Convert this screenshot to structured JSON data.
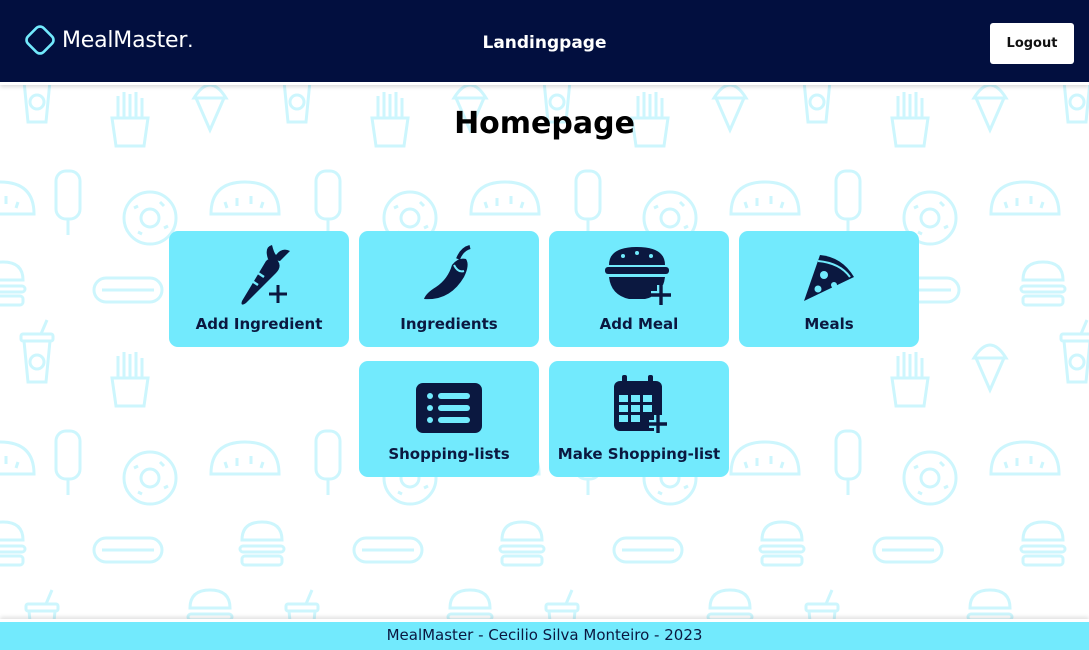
{
  "header": {
    "app_name": "MealMaster",
    "app_name_suffix": ".",
    "page_label": "Landingpage",
    "logout_label": "Logout"
  },
  "main": {
    "title": "Homepage",
    "tiles": [
      {
        "label": "Add Ingredient",
        "icon": "carrot-plus-icon"
      },
      {
        "label": "Ingredients",
        "icon": "pepper-icon"
      },
      {
        "label": "Add Meal",
        "icon": "bowl-plus-icon"
      },
      {
        "label": "Meals",
        "icon": "pizza-slice-icon"
      },
      {
        "label": "Shopping-lists",
        "icon": "list-icon"
      },
      {
        "label": "Make Shopping-list",
        "icon": "calendar-plus-icon"
      }
    ]
  },
  "footer": {
    "text": "MealMaster - Cecilio Silva Monteiro - 2023"
  },
  "colors": {
    "header_bg": "#020f3f",
    "accent": "#72eafd",
    "icon_dark": "#0b1840",
    "pattern": "#cdf6fd"
  }
}
